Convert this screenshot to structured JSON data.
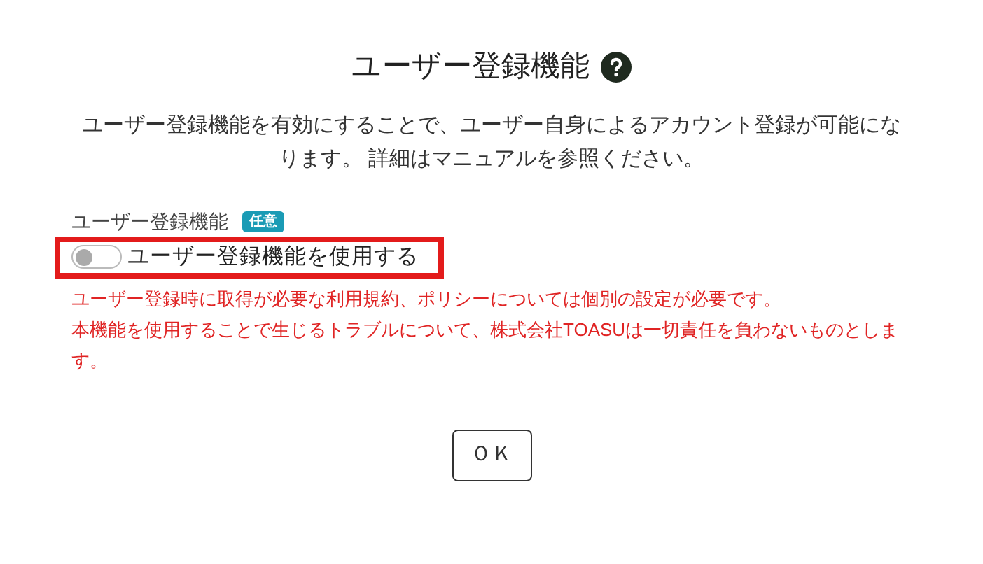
{
  "dialog": {
    "title": "ユーザー登録機能",
    "description": "ユーザー登録機能を有効にすることで、ユーザー自身によるアカウント登録が可能になります。 詳細はマニュアルを参照ください。",
    "field": {
      "label": "ユーザー登録機能",
      "badge": "任意",
      "toggle": {
        "label": "ユーザー登録機能を使用する",
        "on": false,
        "highlighted": true
      }
    },
    "warnings": [
      "ユーザー登録時に取得が必要な利用規約、ポリシーについては個別の設定が必要です。",
      "本機能を使用することで生じるトラブルについて、株式会社TOASUは一切責任を負わないものとします。"
    ],
    "buttons": [
      {
        "label": "ＯＫ"
      }
    ]
  }
}
